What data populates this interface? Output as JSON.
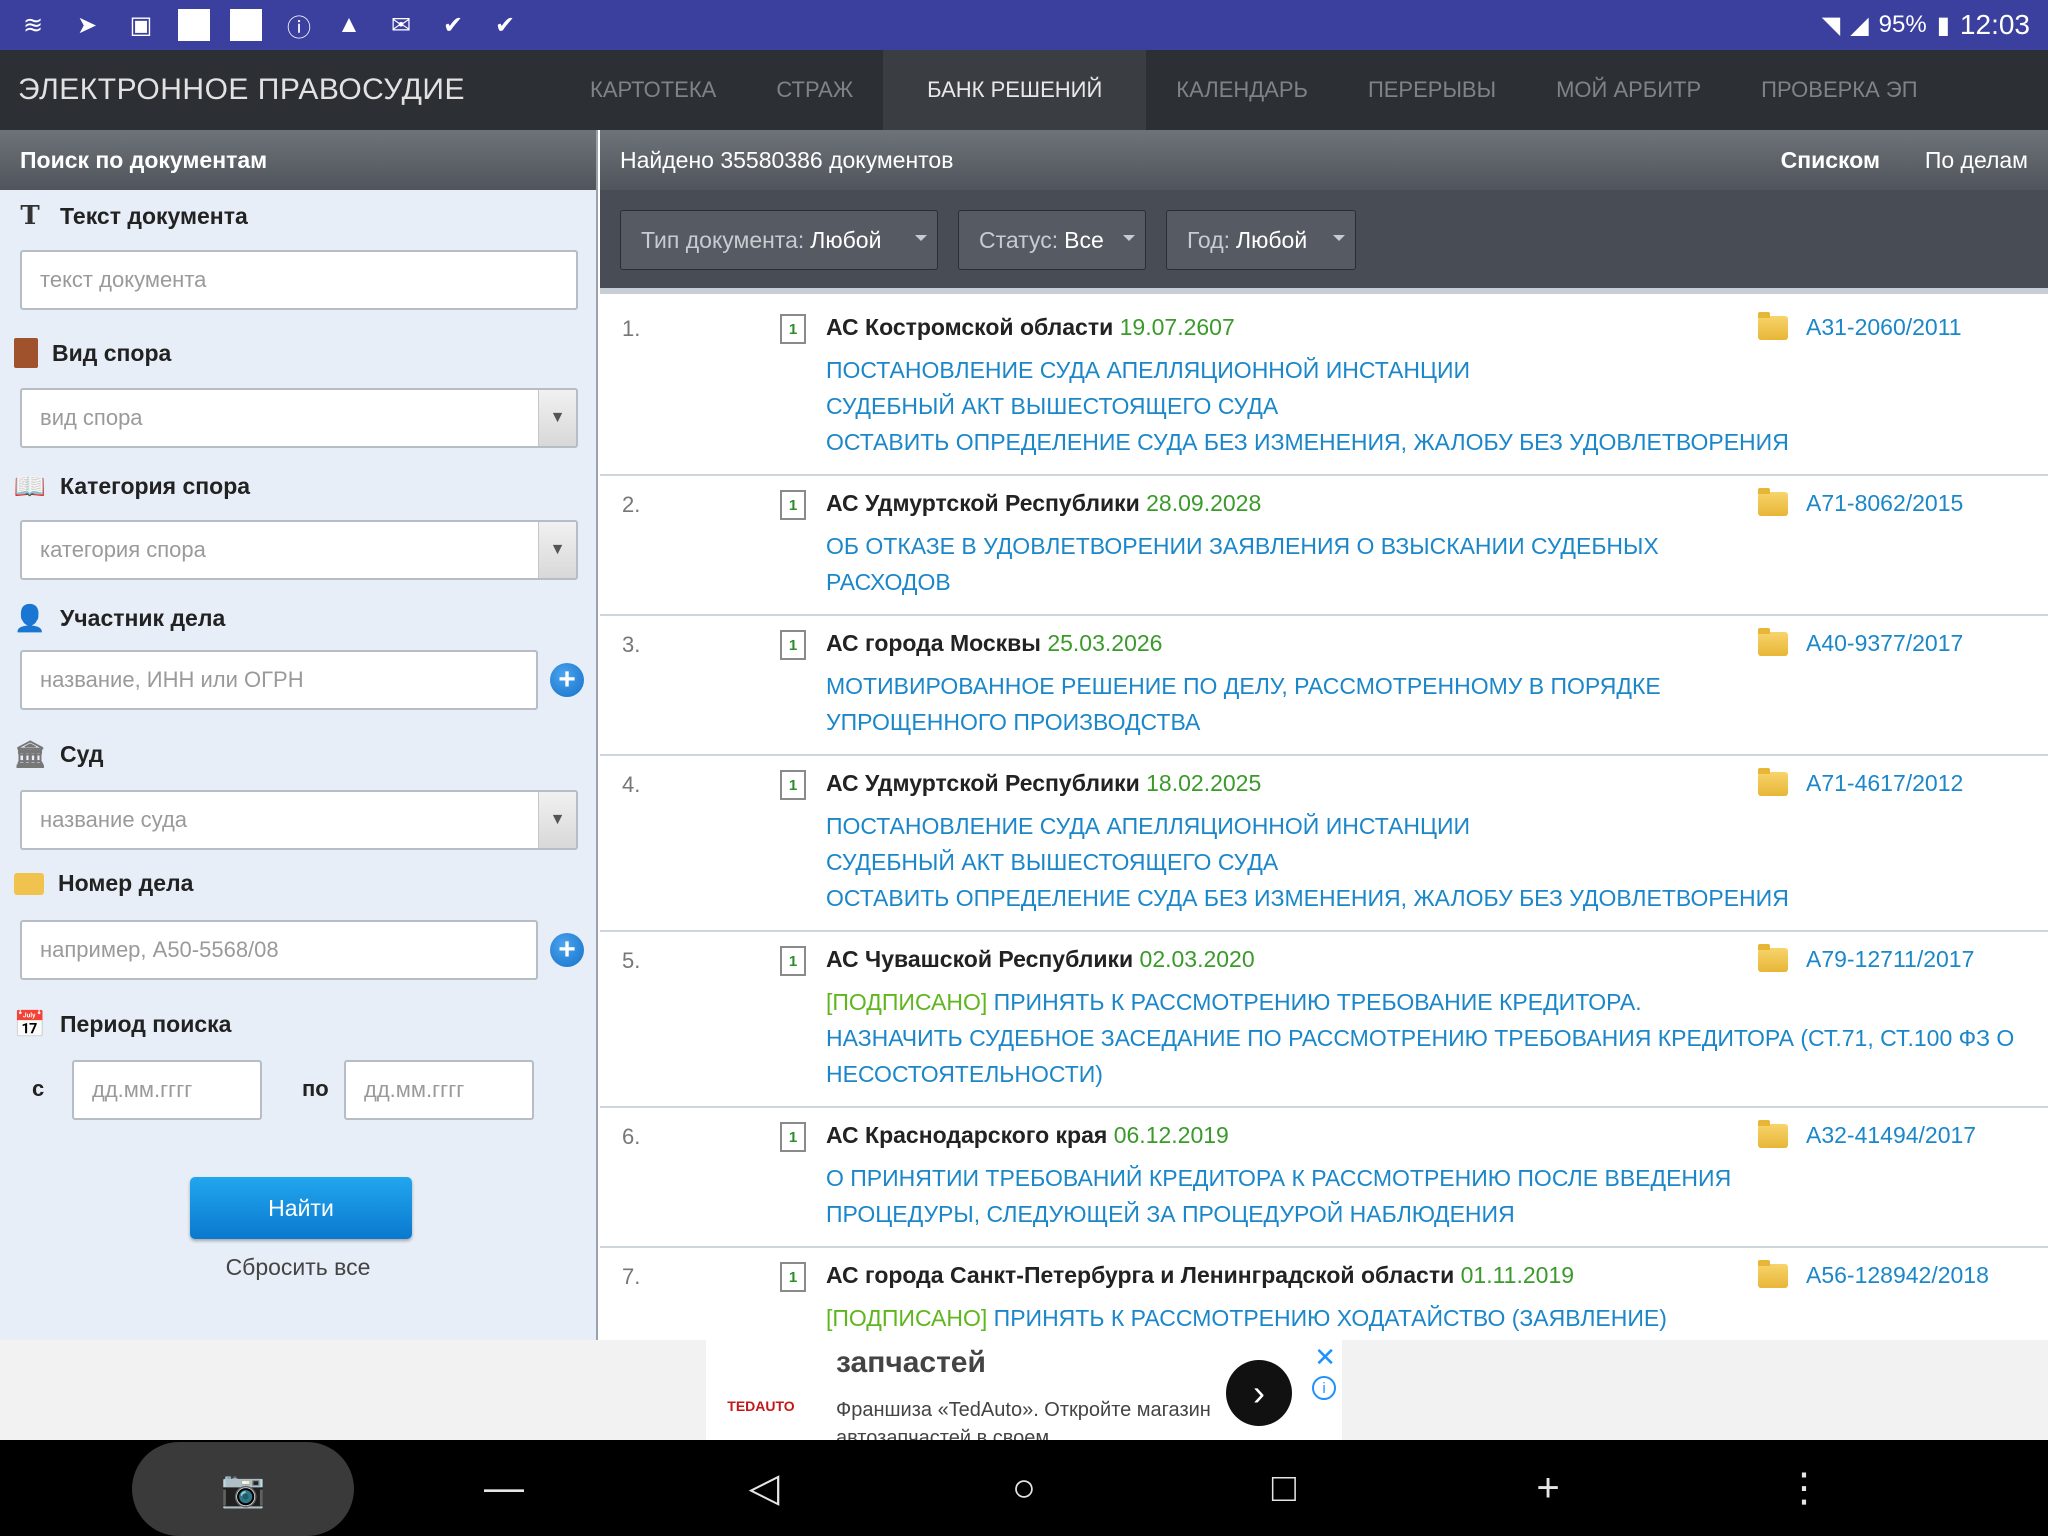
{
  "status_bar": {
    "battery": "95%",
    "time": "12:03",
    "left_icons": [
      "stack-icon",
      "telegram-icon",
      "image-icon",
      "blank-square-icon",
      "blank-square-icon",
      "info-icon",
      "paint-icon",
      "mail-icon",
      "check-icon",
      "check-icon"
    ]
  },
  "app": {
    "brand": "ЭЛЕКТРОННОЕ ПРАВОСУДИЕ",
    "nav": [
      "КАРТОТЕКА",
      "СТРАЖ",
      "БАНК РЕШЕНИЙ",
      "КАЛЕНДАРЬ",
      "ПЕРЕРЫВЫ",
      "МОЙ АРБИТР",
      "ПРОВЕРКА ЭП"
    ],
    "active_nav": "БАНК РЕШЕНИЙ"
  },
  "search": {
    "title": "Поиск по документам",
    "doc_text": {
      "label": "Текст документа",
      "placeholder": "текст документа"
    },
    "dispute_type": {
      "label": "Вид спора",
      "placeholder": "вид спора"
    },
    "dispute_category": {
      "label": "Категория спора",
      "placeholder": "категория спора"
    },
    "participant": {
      "label": "Участник дела",
      "placeholder": "название, ИНН или ОГРН"
    },
    "court": {
      "label": "Суд",
      "placeholder": "название суда"
    },
    "case_number": {
      "label": "Номер дела",
      "placeholder": "например, А50-5568/08"
    },
    "period": {
      "label": "Период поиска",
      "from_label": "с",
      "to_label": "по",
      "from_placeholder": "дд.мм.гггг",
      "to_placeholder": "дд.мм.гггг"
    },
    "find_button": "Найти",
    "reset_link": "Сбросить все"
  },
  "results_header": {
    "found": "Найдено 35580386 документов",
    "view_list": "Списком",
    "view_cases": "По делам"
  },
  "filters": [
    {
      "label": "Тип документа:",
      "value": "Любой"
    },
    {
      "label": "Статус:",
      "value": "Все"
    },
    {
      "label": "Год:",
      "value": "Любой"
    }
  ],
  "results": [
    {
      "num": "1.",
      "court": "АС Костромской области",
      "date": "19.07.2607",
      "case": "А31-2060/2011",
      "signed": "",
      "lines": [
        "ПОСТАНОВЛЕНИЕ СУДА АПЕЛЛЯЦИОННОЙ ИНСТАНЦИИ",
        "СУДЕБНЫЙ АКТ ВЫШЕСТОЯЩЕГО СУДА",
        "ОСТАВИТЬ ОПРЕДЕЛЕНИЕ СУДА БЕЗ ИЗМЕНЕНИЯ, ЖАЛОБУ БЕЗ УДОВЛЕТВОРЕНИЯ"
      ]
    },
    {
      "num": "2.",
      "court": "АС Удмуртской Республики",
      "date": "28.09.2028",
      "case": "А71-8062/2015",
      "signed": "",
      "lines": [
        "ОБ ОТКАЗЕ В УДОВЛЕТВОРЕНИИ ЗАЯВЛЕНИЯ О ВЗЫСКАНИИ СУДЕБНЫХ",
        "РАСХОДОВ"
      ]
    },
    {
      "num": "3.",
      "court": "АС города Москвы",
      "date": "25.03.2026",
      "case": "А40-9377/2017",
      "signed": "",
      "lines": [
        "МОТИВИРОВАННОЕ РЕШЕНИЕ ПО ДЕЛУ, РАССМОТРЕННОМУ В ПОРЯДКЕ",
        "УПРОЩЕННОГО ПРОИЗВОДСТВА"
      ]
    },
    {
      "num": "4.",
      "court": "АС Удмуртской Республики",
      "date": "18.02.2025",
      "case": "А71-4617/2012",
      "signed": "",
      "lines": [
        "ПОСТАНОВЛЕНИЕ СУДА АПЕЛЛЯЦИОННОЙ ИНСТАНЦИИ",
        "СУДЕБНЫЙ АКТ ВЫШЕСТОЯЩЕГО СУДА",
        "ОСТАВИТЬ ОПРЕДЕЛЕНИЕ СУДА БЕЗ ИЗМЕНЕНИЯ, ЖАЛОБУ БЕЗ УДОВЛЕТВОРЕНИЯ"
      ]
    },
    {
      "num": "5.",
      "court": "АС Чувашской Республики",
      "date": "02.03.2020",
      "case": "А79-12711/2017",
      "signed": "[ПОДПИСАНО]",
      "lines": [
        "ПРИНЯТЬ К РАССМОТРЕНИЮ ТРЕБОВАНИЕ КРЕДИТОРА.",
        "НАЗНАЧИТЬ СУДЕБНОЕ ЗАСЕДАНИЕ ПО РАССМОТРЕНИЮ ТРЕБОВАНИЯ КРЕДИТОРА (СТ.71, СТ.100 ФЗ О",
        "НЕСОСТОЯТЕЛЬНОСТИ)"
      ]
    },
    {
      "num": "6.",
      "court": "АС Краснодарского края",
      "date": "06.12.2019",
      "case": "А32-41494/2017",
      "signed": "",
      "lines": [
        "О ПРИНЯТИИ ТРЕБОВАНИЙ КРЕДИТОРА К РАССМОТРЕНИЮ ПОСЛЕ ВВЕДЕНИЯ",
        "ПРОЦЕДУРЫ, СЛЕДУЮЩЕЙ ЗА ПРОЦЕДУРОЙ НАБЛЮДЕНИЯ"
      ]
    },
    {
      "num": "7.",
      "court": "АС города Санкт-Петербурга и Ленинградской области",
      "date": "01.11.2019",
      "case": "А56-128942/2018",
      "signed": "[ПОДПИСАНО]",
      "lines": [
        "ПРИНЯТЬ К РАССМОТРЕНИЮ ХОДАТАЙСТВО (ЗАЯВЛЕНИЕ)"
      ]
    }
  ],
  "ad": {
    "logo": "TEDAUTO",
    "title": "запчастей",
    "text": "Франшиза «TedAuto». Откройте магазин автозапчастей в своем"
  },
  "colors": {
    "statusbar": "#3b3f9e",
    "header": "#2c2f33",
    "link": "#1b87c9",
    "date": "#3a9a2a",
    "signed": "#5fb61d"
  }
}
